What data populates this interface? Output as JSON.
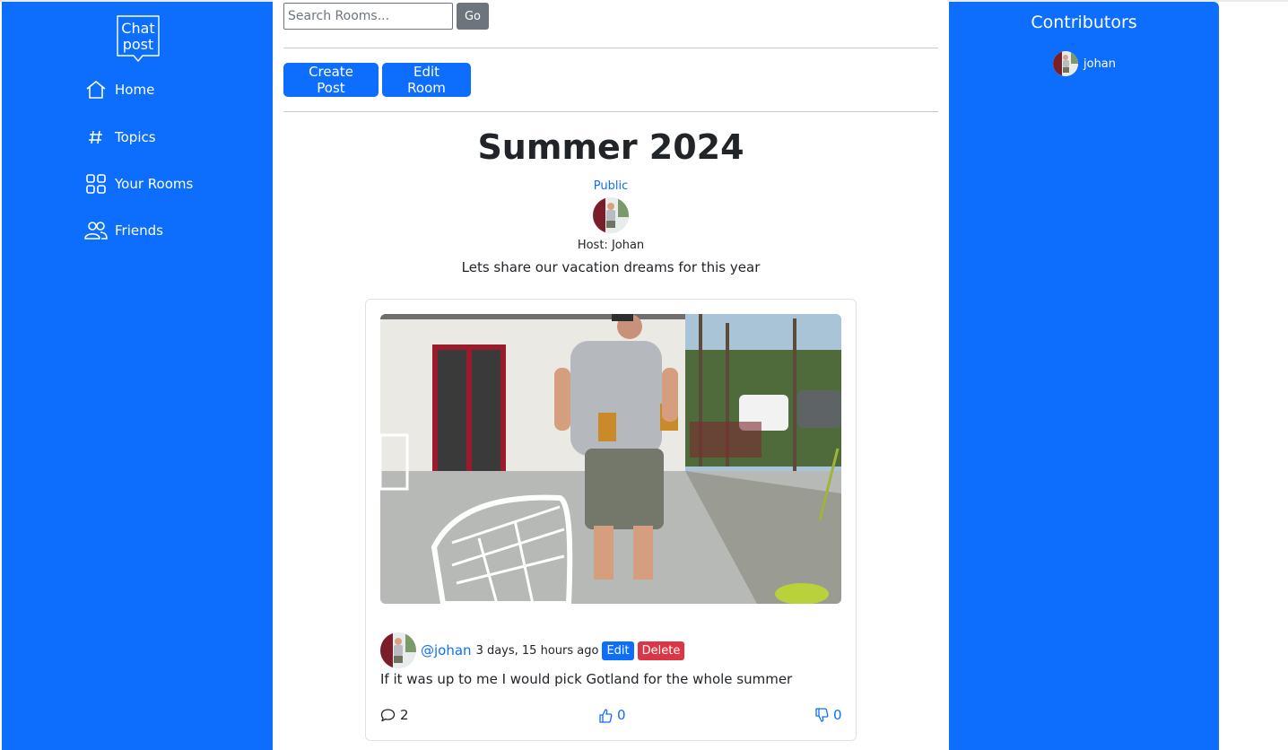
{
  "logo": {
    "line1": "Chat",
    "line2": "post"
  },
  "sidebar": {
    "items": [
      {
        "label": "Home",
        "icon": "home-icon"
      },
      {
        "label": "Topics",
        "icon": "hash-icon"
      },
      {
        "label": "Your Rooms",
        "icon": "grid-icon"
      },
      {
        "label": "Friends",
        "icon": "people-icon"
      }
    ]
  },
  "search": {
    "placeholder": "Search Rooms...",
    "button_label": "Go"
  },
  "actions": {
    "create_post": "Create Post",
    "edit_room": "Edit Room"
  },
  "room": {
    "title": "Summer 2024",
    "status": "Public",
    "host": "Host: Johan",
    "description": "Lets share our vacation dreams for this year"
  },
  "post": {
    "author": "@johan",
    "time": "3 days, 15 hours ago",
    "edit_label": "Edit",
    "delete_label": "Delete",
    "body": "If it was up to me I would pick Gotland for the whole summer",
    "comments": "2",
    "likes": "0",
    "dislikes": "0"
  },
  "contributors": {
    "title": "Contributors",
    "users": [
      {
        "name": "johan"
      }
    ]
  },
  "colors": {
    "primary": "#0d6efd",
    "danger": "#dc3545",
    "secondary": "#6c757d"
  }
}
